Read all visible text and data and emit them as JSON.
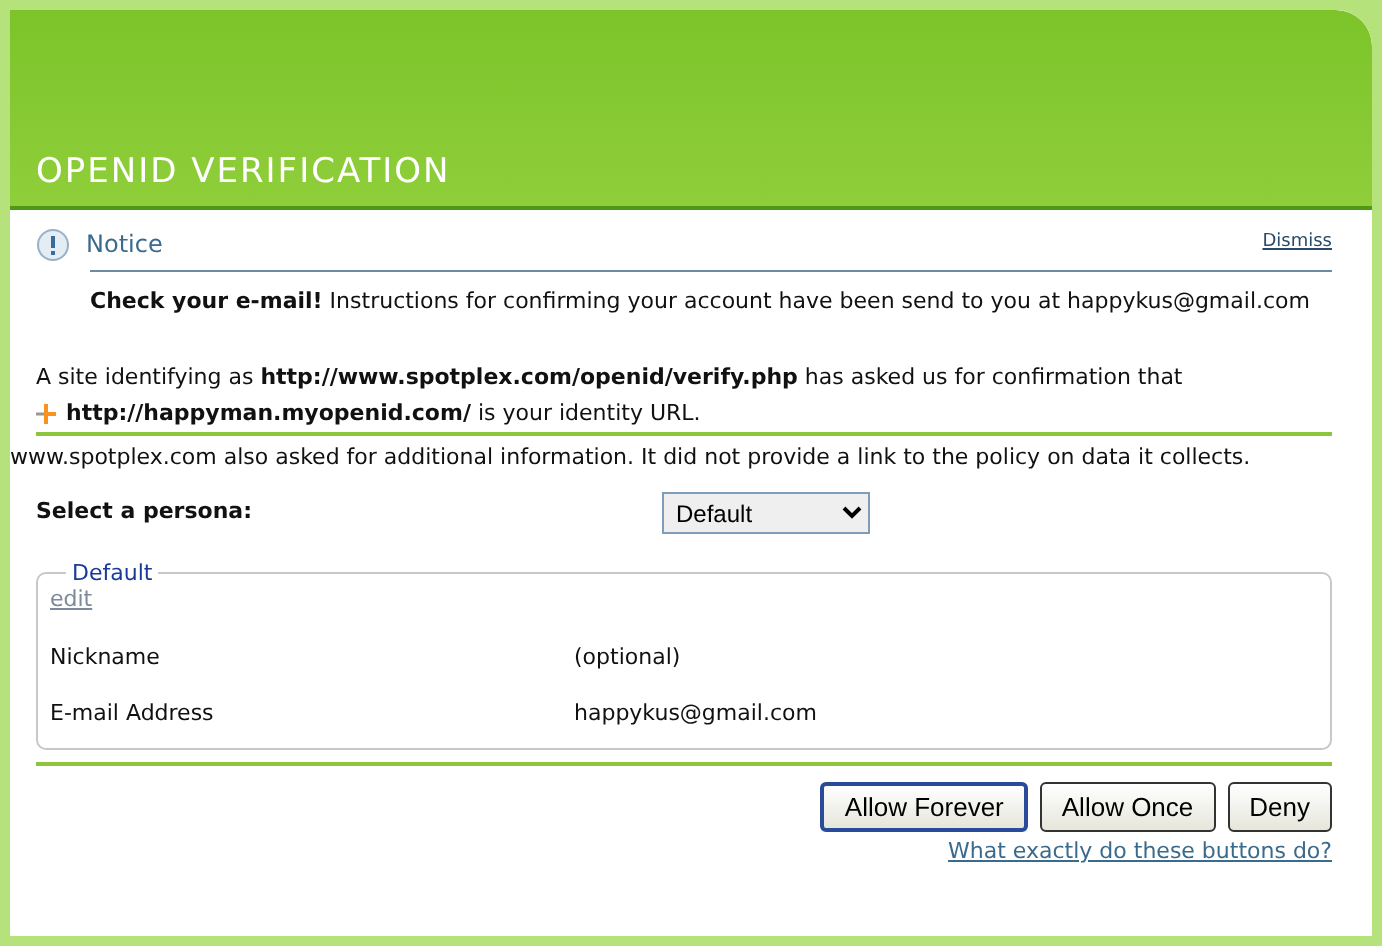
{
  "title": "OPENID VERIFICATION",
  "notice": {
    "heading": "Notice",
    "dismiss": "Dismiss",
    "message": "**Check your e-mail!** Instructions for confirming your account have been send to you at happykus@gmail.com"
  },
  "request": {
    "line_1": "A site identifying as **http://www.spotplex.com/openid/verify.php** has asked us for confirmation that",
    "line_2": "**http://happyman.myopenid.com/** is your identity URL."
  },
  "additional_info": "www.spotplex.com also asked for additional information. It did not provide a link to the policy on data it collects.",
  "persona": {
    "label": "Select a persona:",
    "value": "Default"
  },
  "fieldset": {
    "legend": "Default",
    "edit": "edit",
    "fields": [
      {
        "label": "Nickname",
        "value": "(optional)"
      },
      {
        "label": "E-mail Address",
        "value": "happykus@gmail.com"
      }
    ]
  },
  "buttons": [
    {
      "label": "Allow Forever",
      "default": true
    },
    {
      "label": "Allow Once",
      "default": false
    },
    {
      "label": "Deny",
      "default": false
    }
  ],
  "help_link": "What exactly do these buttons do?"
}
